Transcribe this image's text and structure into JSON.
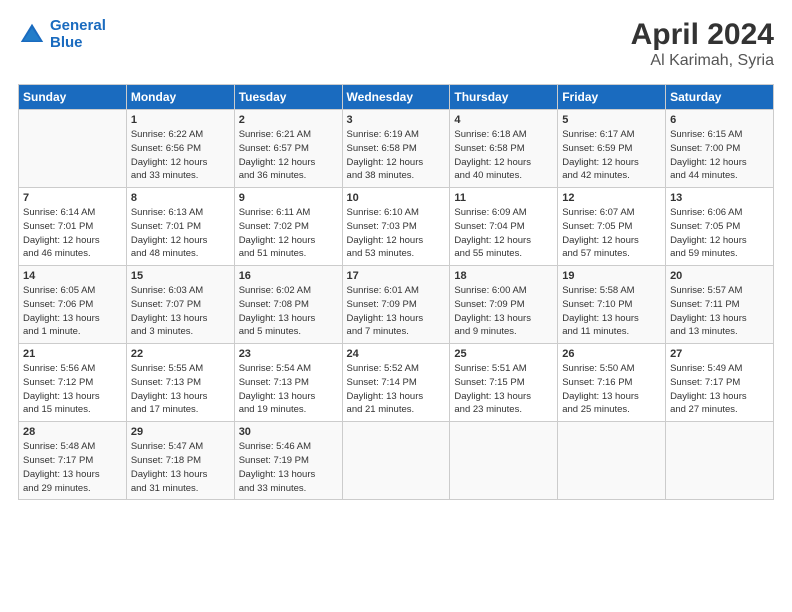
{
  "header": {
    "logo_line1": "General",
    "logo_line2": "Blue",
    "month": "April 2024",
    "location": "Al Karimah, Syria"
  },
  "days_of_week": [
    "Sunday",
    "Monday",
    "Tuesday",
    "Wednesday",
    "Thursday",
    "Friday",
    "Saturday"
  ],
  "weeks": [
    [
      {
        "day": "",
        "info": ""
      },
      {
        "day": "1",
        "info": "Sunrise: 6:22 AM\nSunset: 6:56 PM\nDaylight: 12 hours\nand 33 minutes."
      },
      {
        "day": "2",
        "info": "Sunrise: 6:21 AM\nSunset: 6:57 PM\nDaylight: 12 hours\nand 36 minutes."
      },
      {
        "day": "3",
        "info": "Sunrise: 6:19 AM\nSunset: 6:58 PM\nDaylight: 12 hours\nand 38 minutes."
      },
      {
        "day": "4",
        "info": "Sunrise: 6:18 AM\nSunset: 6:58 PM\nDaylight: 12 hours\nand 40 minutes."
      },
      {
        "day": "5",
        "info": "Sunrise: 6:17 AM\nSunset: 6:59 PM\nDaylight: 12 hours\nand 42 minutes."
      },
      {
        "day": "6",
        "info": "Sunrise: 6:15 AM\nSunset: 7:00 PM\nDaylight: 12 hours\nand 44 minutes."
      }
    ],
    [
      {
        "day": "7",
        "info": "Sunrise: 6:14 AM\nSunset: 7:01 PM\nDaylight: 12 hours\nand 46 minutes."
      },
      {
        "day": "8",
        "info": "Sunrise: 6:13 AM\nSunset: 7:01 PM\nDaylight: 12 hours\nand 48 minutes."
      },
      {
        "day": "9",
        "info": "Sunrise: 6:11 AM\nSunset: 7:02 PM\nDaylight: 12 hours\nand 51 minutes."
      },
      {
        "day": "10",
        "info": "Sunrise: 6:10 AM\nSunset: 7:03 PM\nDaylight: 12 hours\nand 53 minutes."
      },
      {
        "day": "11",
        "info": "Sunrise: 6:09 AM\nSunset: 7:04 PM\nDaylight: 12 hours\nand 55 minutes."
      },
      {
        "day": "12",
        "info": "Sunrise: 6:07 AM\nSunset: 7:05 PM\nDaylight: 12 hours\nand 57 minutes."
      },
      {
        "day": "13",
        "info": "Sunrise: 6:06 AM\nSunset: 7:05 PM\nDaylight: 12 hours\nand 59 minutes."
      }
    ],
    [
      {
        "day": "14",
        "info": "Sunrise: 6:05 AM\nSunset: 7:06 PM\nDaylight: 13 hours\nand 1 minute."
      },
      {
        "day": "15",
        "info": "Sunrise: 6:03 AM\nSunset: 7:07 PM\nDaylight: 13 hours\nand 3 minutes."
      },
      {
        "day": "16",
        "info": "Sunrise: 6:02 AM\nSunset: 7:08 PM\nDaylight: 13 hours\nand 5 minutes."
      },
      {
        "day": "17",
        "info": "Sunrise: 6:01 AM\nSunset: 7:09 PM\nDaylight: 13 hours\nand 7 minutes."
      },
      {
        "day": "18",
        "info": "Sunrise: 6:00 AM\nSunset: 7:09 PM\nDaylight: 13 hours\nand 9 minutes."
      },
      {
        "day": "19",
        "info": "Sunrise: 5:58 AM\nSunset: 7:10 PM\nDaylight: 13 hours\nand 11 minutes."
      },
      {
        "day": "20",
        "info": "Sunrise: 5:57 AM\nSunset: 7:11 PM\nDaylight: 13 hours\nand 13 minutes."
      }
    ],
    [
      {
        "day": "21",
        "info": "Sunrise: 5:56 AM\nSunset: 7:12 PM\nDaylight: 13 hours\nand 15 minutes."
      },
      {
        "day": "22",
        "info": "Sunrise: 5:55 AM\nSunset: 7:13 PM\nDaylight: 13 hours\nand 17 minutes."
      },
      {
        "day": "23",
        "info": "Sunrise: 5:54 AM\nSunset: 7:13 PM\nDaylight: 13 hours\nand 19 minutes."
      },
      {
        "day": "24",
        "info": "Sunrise: 5:52 AM\nSunset: 7:14 PM\nDaylight: 13 hours\nand 21 minutes."
      },
      {
        "day": "25",
        "info": "Sunrise: 5:51 AM\nSunset: 7:15 PM\nDaylight: 13 hours\nand 23 minutes."
      },
      {
        "day": "26",
        "info": "Sunrise: 5:50 AM\nSunset: 7:16 PM\nDaylight: 13 hours\nand 25 minutes."
      },
      {
        "day": "27",
        "info": "Sunrise: 5:49 AM\nSunset: 7:17 PM\nDaylight: 13 hours\nand 27 minutes."
      }
    ],
    [
      {
        "day": "28",
        "info": "Sunrise: 5:48 AM\nSunset: 7:17 PM\nDaylight: 13 hours\nand 29 minutes."
      },
      {
        "day": "29",
        "info": "Sunrise: 5:47 AM\nSunset: 7:18 PM\nDaylight: 13 hours\nand 31 minutes."
      },
      {
        "day": "30",
        "info": "Sunrise: 5:46 AM\nSunset: 7:19 PM\nDaylight: 13 hours\nand 33 minutes."
      },
      {
        "day": "",
        "info": ""
      },
      {
        "day": "",
        "info": ""
      },
      {
        "day": "",
        "info": ""
      },
      {
        "day": "",
        "info": ""
      }
    ]
  ]
}
